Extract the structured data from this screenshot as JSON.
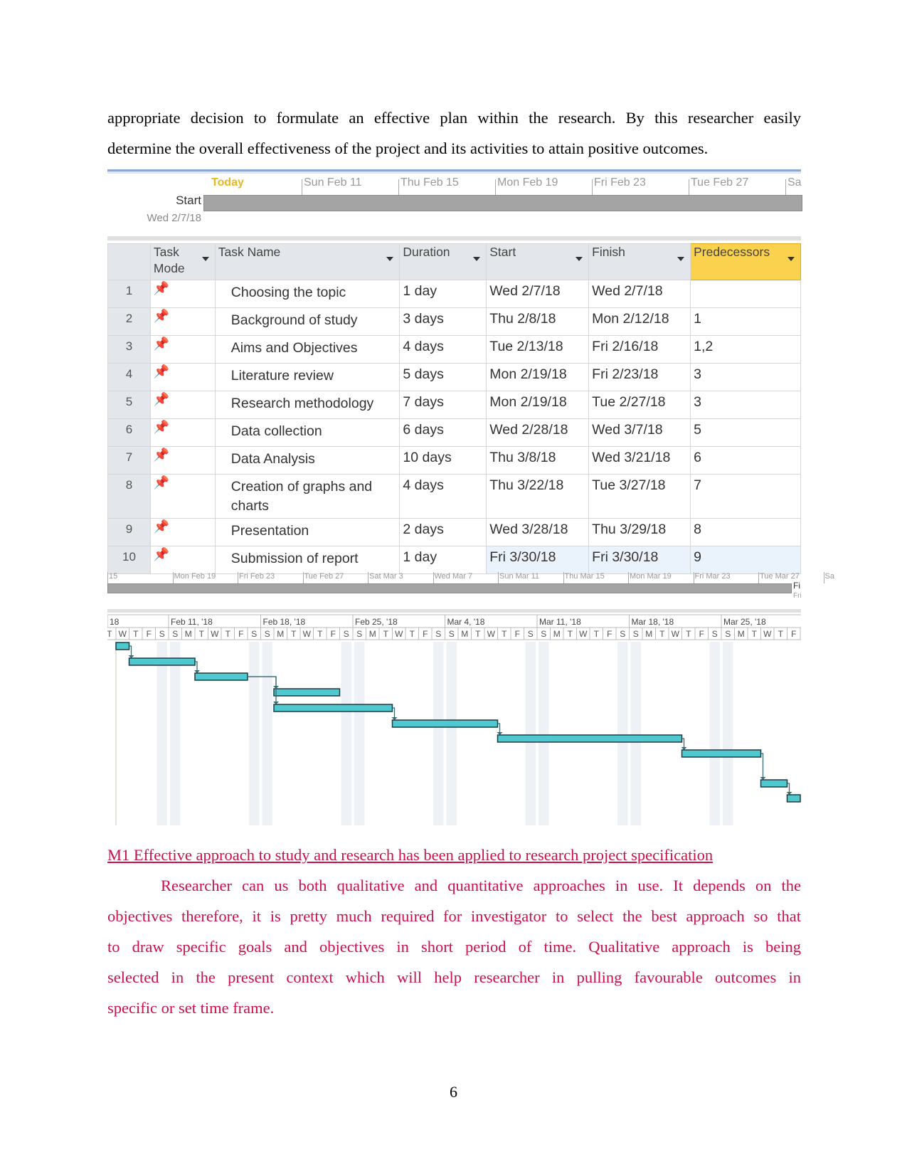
{
  "intro_lines": [
    "appropriate decision to formulate an effective plan within the research. By this researcher easily",
    "determine the overall effectiveness of the project and its activities to attain positive outcomes."
  ],
  "timeline_top": {
    "today": "Today",
    "labels": [
      "Sun Feb 11",
      "Thu Feb 15",
      "Mon Feb 19",
      "Fri Feb 23",
      "Tue Feb 27",
      "Sa"
    ],
    "start_label": "Start",
    "start_date": "Wed 2/7/18"
  },
  "table": {
    "headers": {
      "mode": "Task Mode",
      "name": "Task Name",
      "duration": "Duration",
      "start": "Start",
      "finish": "Finish",
      "pred": "Predecessors"
    },
    "rows": [
      {
        "id": "1",
        "name": "Choosing the topic",
        "duration": "1 day",
        "start": "Wed 2/7/18",
        "finish": "Wed 2/7/18",
        "pred": ""
      },
      {
        "id": "2",
        "name": "Background of study",
        "duration": "3 days",
        "start": "Thu 2/8/18",
        "finish": "Mon 2/12/18",
        "pred": "1"
      },
      {
        "id": "3",
        "name": "Aims and Objectives",
        "duration": "4 days",
        "start": "Tue 2/13/18",
        "finish": "Fri 2/16/18",
        "pred": "1,2"
      },
      {
        "id": "4",
        "name": "Literature review",
        "duration": "5 days",
        "start": "Mon 2/19/18",
        "finish": "Fri 2/23/18",
        "pred": "3"
      },
      {
        "id": "5",
        "name": "Research methodology",
        "duration": "7 days",
        "start": "Mon 2/19/18",
        "finish": "Tue 2/27/18",
        "pred": "3"
      },
      {
        "id": "6",
        "name": "Data collection",
        "duration": "6 days",
        "start": "Wed 2/28/18",
        "finish": "Wed 3/7/18",
        "pred": "5"
      },
      {
        "id": "7",
        "name": "Data Analysis",
        "duration": "10 days",
        "start": "Thu 3/8/18",
        "finish": "Wed 3/21/18",
        "pred": "6"
      },
      {
        "id": "8",
        "name": "Creation of graphs and charts",
        "duration": "4 days",
        "start": "Thu 3/22/18",
        "finish": "Tue 3/27/18",
        "pred": "7"
      },
      {
        "id": "9",
        "name": "Presentation",
        "duration": "2 days",
        "start": "Wed 3/28/18",
        "finish": "Thu 3/29/18",
        "pred": "8"
      },
      {
        "id": "10",
        "name": "Submission of report",
        "duration": "1 day",
        "start": "Fri 3/30/18",
        "finish": "Fri 3/30/18",
        "pred": "9"
      }
    ]
  },
  "timeline_bottom": {
    "labels": [
      "15",
      "Mon Feb 19",
      "Fri Feb 23",
      "Tue Feb 27",
      "Sat Mar 3",
      "Wed Mar 7",
      "Sun Mar 11",
      "Thu Mar 15",
      "Mon Mar 19",
      "Fri Mar 23",
      "Tue Mar 27",
      "Sa"
    ],
    "finish_label": "Fi",
    "finish_date": "Fri"
  },
  "gantt": {
    "weeks": [
      "18",
      "Feb 11, '18",
      "Feb 18, '18",
      "Feb 25, '18",
      "Mar 4, '18",
      "Mar 11, '18",
      "Mar 18, '18",
      "Mar 25, '18"
    ],
    "bar_color": "#4fc8d0"
  },
  "heading": "M1 Effective approach to study and research has been applied to research project specification",
  "body_lines": [
    "Researcher can us both qualitative and quantitative approaches in use. It depends on the",
    "objectives therefore, it is pretty much required for investigator to select the best approach so that",
    "to draw specific goals and objectives in short period of time. Qualitative approach is being",
    "selected in the present context which will help researcher in pulling favourable outcomes in",
    "specific or set time frame."
  ],
  "accent_color": "#c8104a",
  "page_number": "6"
}
